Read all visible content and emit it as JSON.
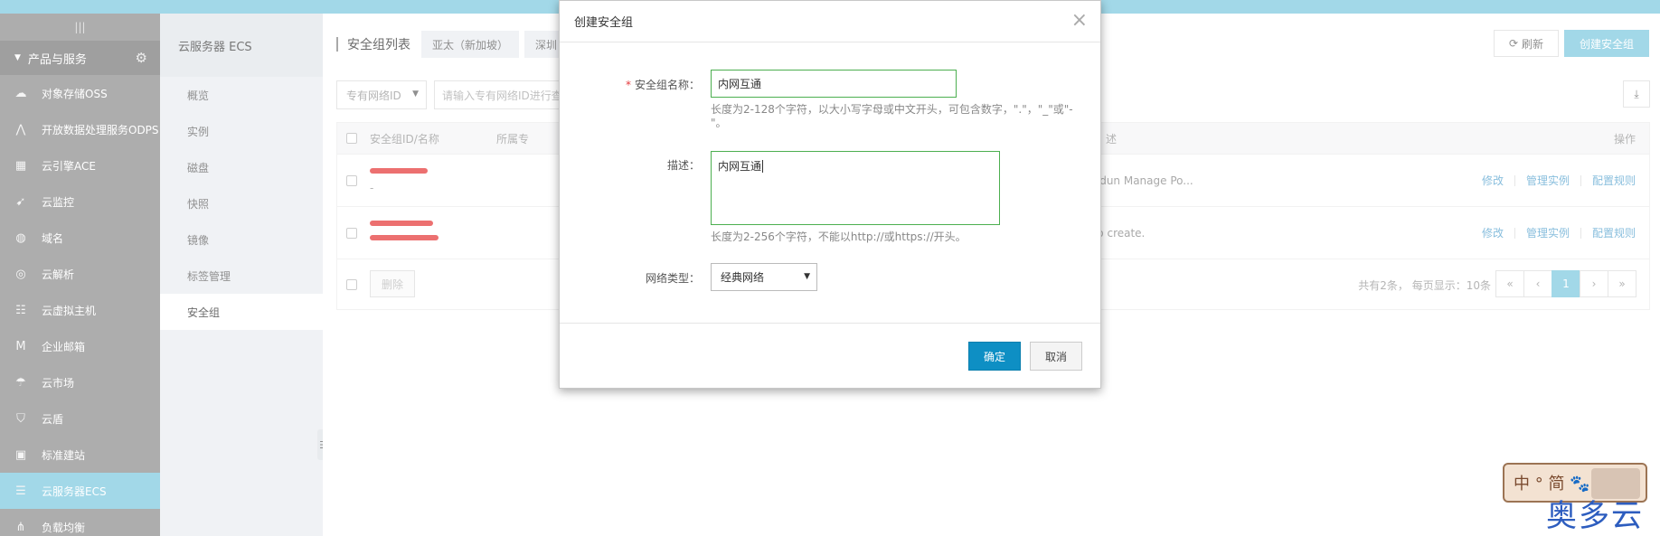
{
  "leftnav": {
    "collapse_icon": "|||",
    "group_label": "产品与服务",
    "items": [
      {
        "label": "对象存储OSS",
        "icon": "cloud-upload-icon"
      },
      {
        "label": "开放数据处理服务ODPS",
        "icon": "odps-icon"
      },
      {
        "label": "云引擎ACE",
        "icon": "grid-icon"
      },
      {
        "label": "云监控",
        "icon": "monitor-icon"
      },
      {
        "label": "域名",
        "icon": "globe-icon"
      },
      {
        "label": "云解析",
        "icon": "dns-icon"
      },
      {
        "label": "云虚拟主机",
        "icon": "server-icon"
      },
      {
        "label": "企业邮箱",
        "icon": "mail-icon"
      },
      {
        "label": "云市场",
        "icon": "market-icon"
      },
      {
        "label": "云盾",
        "icon": "shield-icon"
      },
      {
        "label": "标准建站",
        "icon": "site-icon"
      },
      {
        "label": "云服务器ECS",
        "icon": "ecs-icon"
      },
      {
        "label": "负载均衡",
        "icon": "balance-icon"
      }
    ],
    "active_index": 11
  },
  "subnav": {
    "title": "云服务器 ECS",
    "items": [
      "概览",
      "实例",
      "磁盘",
      "快照",
      "镜像",
      "标签管理",
      "安全组"
    ],
    "active_index": 6
  },
  "main": {
    "tab_label": "安全组列表",
    "regions": [
      "亚太（新加坡）",
      "深圳"
    ],
    "refresh_label": "刷新",
    "create_label": "创建安全组",
    "filter_select": "专有网络ID",
    "filter_placeholder": "请输入专有网络ID进行查",
    "columns": {
      "id_name": "安全组ID/名称",
      "vpc": "所属专",
      "desc": "述",
      "ops": "操作"
    },
    "rows": [
      {
        "name_sub": "-",
        "desc": "undun Manage Po...",
        "ops": [
          "修改",
          "管理实例",
          "配置规则"
        ]
      },
      {
        "name_sub": "",
        "desc": "uto create.",
        "ops": [
          "修改",
          "管理实例",
          "配置规则"
        ]
      }
    ],
    "delete_label": "删除",
    "pager_info": "共有2条， 每页显示：10条",
    "pager": [
      "«",
      "‹",
      "1",
      "›",
      "»"
    ],
    "current_page": "1"
  },
  "modal": {
    "title": "创建安全组",
    "close": "×",
    "name_label": "安全组名称：",
    "required_mark": "*",
    "name_value": "内网互通",
    "name_help": "长度为2-128个字符，以大小写字母或中文开头，可包含数字，\".\"，\"_\"或\"-",
    "name_help_2": "\"。",
    "desc_label": "描述：",
    "desc_value": "内网互通",
    "desc_help": "长度为2-256个字符，不能以http://或https://开头。",
    "net_label": "网络类型：",
    "net_value": "经典网络",
    "ok_label": "确定",
    "cancel_label": "取消"
  },
  "watermark": {
    "box_text": "中 ° 简 🐾",
    "site_text": "奥多云"
  }
}
